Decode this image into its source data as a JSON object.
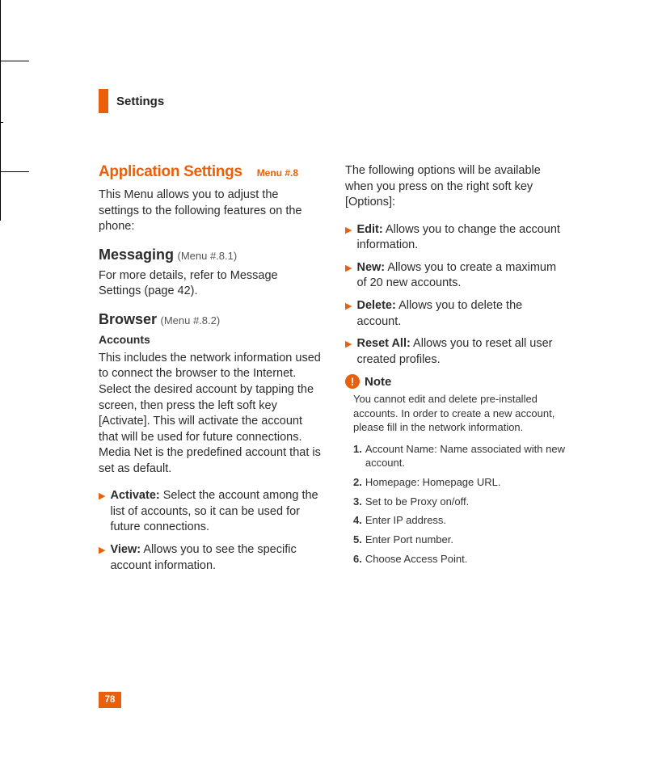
{
  "chapter": {
    "title": "Settings"
  },
  "section": {
    "title": "Application Settings",
    "menu_ref": "Menu #.8",
    "intro": "This Menu allows you to adjust the settings to the following features on the phone:"
  },
  "messaging": {
    "heading": "Messaging",
    "ref": "(Menu #.8.1)",
    "text": "For more details, refer to Message Settings (page 42)."
  },
  "browser": {
    "heading": "Browser",
    "ref": "(Menu #.8.2)",
    "accounts_heading": "Accounts",
    "accounts_text": "This includes the network information used to connect the browser to the Internet. Select the desired account by tapping the screen, then press the left soft key [Activate]. This will activate the account that will be used for future connections. Media Net is the predefined account that is set as default.",
    "bullets_left": [
      {
        "term": "Activate:",
        "desc": "Select the account among the list of accounts, so it can be used for future connections."
      },
      {
        "term": "View:",
        "desc": "Allows you to see the specific account information."
      }
    ]
  },
  "right_col": {
    "intro": "The following options will be available when you press on the right soft key [Options]:",
    "bullets": [
      {
        "term": "Edit:",
        "desc": "Allows you to change the account information."
      },
      {
        "term": "New:",
        "desc": "Allows you to create a maximum of 20 new accounts."
      },
      {
        "term": "Delete:",
        "desc": "Allows you to delete the account."
      },
      {
        "term": "Reset All:",
        "desc": "Allows you to reset all user created profiles."
      }
    ]
  },
  "note": {
    "title": "Note",
    "text": "You cannot edit and delete pre-installed accounts. In order to create a new account, please fill in the network information.",
    "steps": [
      {
        "n": "1.",
        "t": "Account Name: Name associated with new account."
      },
      {
        "n": "2.",
        "t": "Homepage: Homepage URL."
      },
      {
        "n": "3.",
        "t": "Set to be Proxy on/off."
      },
      {
        "n": "4.",
        "t": "Enter IP address."
      },
      {
        "n": "5.",
        "t": "Enter Port number."
      },
      {
        "n": "6.",
        "t": "Choose Access Point."
      }
    ]
  },
  "page_number": "78"
}
